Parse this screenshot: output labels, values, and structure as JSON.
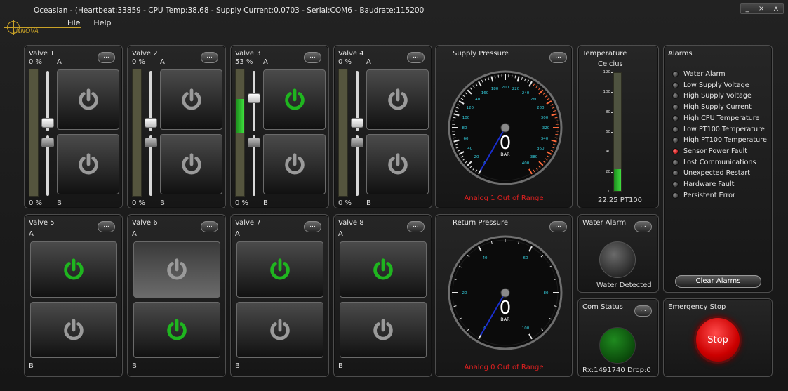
{
  "window": {
    "title": "Oceasian - (Heartbeat:33859 - CPU Temp:38.68 - Supply Current:0.0703 - Serial:COM6 - Baudrate:115200",
    "min_label": "_",
    "restore_label": "×",
    "close_label": "X",
    "logo_text": "INNOVA",
    "accent": "#c9a227"
  },
  "menu": {
    "file": "File",
    "help": "Help"
  },
  "dots_label": "...",
  "valves_top": [
    {
      "title": "Valve 1",
      "percent": "0 %",
      "label_a": "A",
      "percent_b": "0 %",
      "label_b": "B",
      "level": 0,
      "active_a": false,
      "active_b": false
    },
    {
      "title": "Valve 2",
      "percent": "0 %",
      "label_a": "A",
      "percent_b": "0 %",
      "label_b": "B",
      "level": 0,
      "active_a": false,
      "active_b": false
    },
    {
      "title": "Valve 3",
      "percent": "53 %",
      "label_a": "A",
      "percent_b": "0 %",
      "label_b": "B",
      "level": 53,
      "active_a": true,
      "active_b": false
    },
    {
      "title": "Valve 4",
      "percent": "0 %",
      "label_a": "A",
      "percent_b": "0 %",
      "label_b": "B",
      "level": 0,
      "active_a": false,
      "active_b": false
    }
  ],
  "valves_bottom": [
    {
      "title": "Valve 5",
      "label_a": "A",
      "label_b": "B",
      "active_a": true,
      "active_b": false
    },
    {
      "title": "Valve 6",
      "label_a": "A",
      "label_b": "B",
      "active_a": false,
      "active_b": true
    },
    {
      "title": "Valve 7",
      "label_a": "A",
      "label_b": "B",
      "active_a": true,
      "active_b": false
    },
    {
      "title": "Valve 8",
      "label_a": "A",
      "label_b": "B",
      "active_a": true,
      "active_b": false
    }
  ],
  "supply_pressure": {
    "title": "Supply Pressure",
    "value": "0",
    "unit": "BAR",
    "error": "Analog 1 Out of Range",
    "ticks": [
      "0",
      "20",
      "40",
      "60",
      "80",
      "100",
      "120",
      "140",
      "160",
      "180",
      "200",
      "220",
      "240",
      "260",
      "280",
      "300",
      "320",
      "340",
      "360",
      "380",
      "400"
    ]
  },
  "return_pressure": {
    "title": "Return Pressure",
    "value": "0",
    "unit": "BAR",
    "error": "Analog 0 Out of Range",
    "ticks": [
      "0",
      "20",
      "40",
      "60",
      "80",
      "100"
    ]
  },
  "temperature": {
    "title": "Temperature",
    "unit": "Celcius",
    "ticks": [
      "120",
      "100",
      "80",
      "60",
      "40",
      "20",
      "0"
    ],
    "level": 22.25,
    "max": 120,
    "readout": "22.25 PT100"
  },
  "alarms": {
    "title": "Alarms",
    "items": [
      {
        "label": "Water Alarm",
        "on": false
      },
      {
        "label": "Low Supply Voltage",
        "on": false
      },
      {
        "label": "High Supply Voltage",
        "on": false
      },
      {
        "label": "High Supply Current",
        "on": false
      },
      {
        "label": "High CPU Temperature",
        "on": false
      },
      {
        "label": "Low PT100 Temperature",
        "on": false
      },
      {
        "label": "High PT100 Temperature",
        "on": false
      },
      {
        "label": "Sensor Power Fault",
        "on": true
      },
      {
        "label": "Lost Communications",
        "on": false
      },
      {
        "label": "Unexpected Restart",
        "on": false
      },
      {
        "label": "Hardware Fault",
        "on": false
      },
      {
        "label": "Persistent Error",
        "on": false
      }
    ],
    "clear_label": "Clear Alarms"
  },
  "water_alarm": {
    "title": "Water Alarm",
    "status": "Water Detected"
  },
  "com_status": {
    "title": "Com Status",
    "status": "Rx:1491740 Drop:0"
  },
  "emergency": {
    "title": "Emergency Stop",
    "button": "Stop"
  }
}
